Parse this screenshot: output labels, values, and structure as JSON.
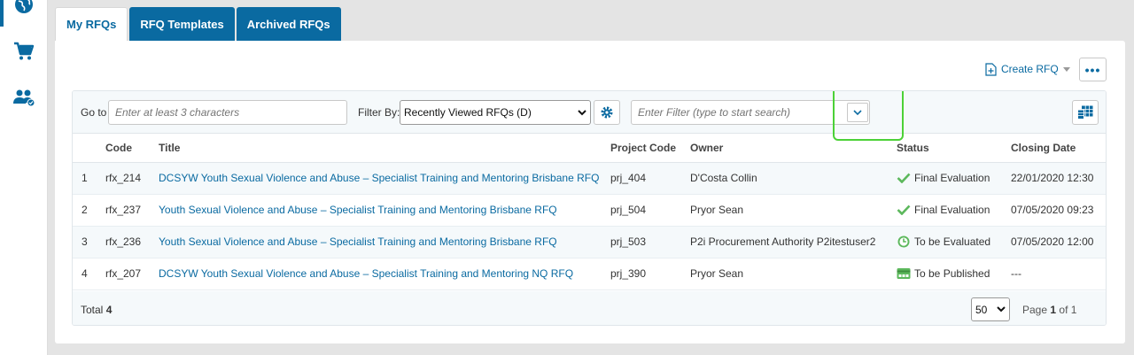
{
  "sidebar": {
    "items": [
      {
        "icon": "globe-icon"
      },
      {
        "icon": "cart-icon"
      },
      {
        "icon": "users-icon"
      }
    ]
  },
  "tabs": [
    {
      "label": "My RFQs",
      "active": true
    },
    {
      "label": "RFQ Templates",
      "active": false
    },
    {
      "label": "Archived RFQs",
      "active": false
    }
  ],
  "actions": {
    "create_label": "Create RFQ",
    "more_label": "•••"
  },
  "toolbar": {
    "goto_label": "Go to",
    "goto_placeholder": "Enter at least 3 characters",
    "filter_by_label": "Filter By:",
    "filter_by_value": "Recently Viewed RFQs (D)",
    "filter_placeholder": "Enter Filter (type to start search)"
  },
  "table": {
    "columns": [
      "",
      "Code",
      "Title",
      "Project Code",
      "Owner",
      "Status",
      "Closing Date"
    ],
    "rows": [
      {
        "num": "1",
        "code": "rfx_214",
        "title": "DCSYW Youth Sexual Violence and Abuse – Specialist Training and Mentoring Brisbane RFQ",
        "project": "prj_404",
        "owner": "D'Costa Collin",
        "status": "Final Evaluation",
        "status_icon": "check-icon",
        "closing": "22/01/2020 12:30"
      },
      {
        "num": "2",
        "code": "rfx_237",
        "title": "Youth Sexual Violence and Abuse – Specialist Training and Mentoring Brisbane RFQ",
        "project": "prj_504",
        "owner": "Pryor Sean",
        "status": "Final Evaluation",
        "status_icon": "check-icon",
        "closing": "07/05/2020 09:23"
      },
      {
        "num": "3",
        "code": "rfx_236",
        "title": "Youth Sexual Violence and Abuse – Specialist Training and Mentoring Brisbane RFQ",
        "project": "prj_503",
        "owner": "P2i Procurement Authority P2itestuser2",
        "status": "To be Evaluated",
        "status_icon": "clock-icon",
        "closing": "07/05/2020 12:00"
      },
      {
        "num": "4",
        "code": "rfx_207",
        "title": "DCSYW Youth Sexual Violence and Abuse – Specialist Training and Mentoring NQ RFQ",
        "project": "prj_390",
        "owner": "Pryor Sean",
        "status": "To be Published",
        "status_icon": "publish-icon",
        "closing": "---"
      }
    ]
  },
  "footer": {
    "total_label": "Total",
    "total_value": "4",
    "page_size": "50",
    "page_label": "Page",
    "page_current": "1",
    "page_of": "of 1"
  },
  "colors": {
    "brand": "#0a6aa1",
    "success": "#5cb85c",
    "highlight": "#4cd137"
  }
}
